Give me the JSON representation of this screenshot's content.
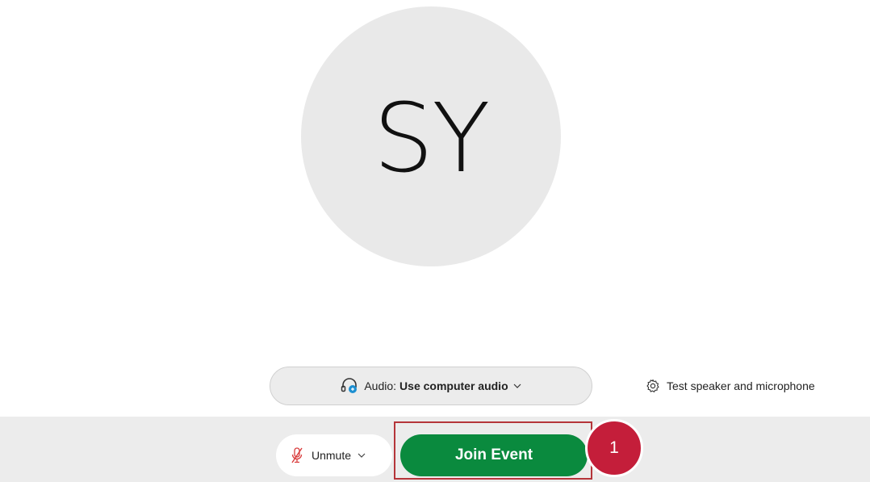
{
  "avatar": {
    "initials": "SY"
  },
  "audio": {
    "prefix": "Audio:",
    "value": "Use computer audio",
    "icon": "headset-icon"
  },
  "test_speaker": {
    "label": "Test speaker and microphone",
    "icon": "gear-icon"
  },
  "controls": {
    "unmute_label": "Unmute",
    "join_label": "Join Event"
  },
  "annotation": {
    "step": "1"
  },
  "colors": {
    "join_green": "#0a8a3e",
    "badge_red": "#c41e3a",
    "highlight_border": "#b5353a",
    "mic_muted_red": "#d93c3c",
    "avatar_bg": "#e9e9e9"
  }
}
